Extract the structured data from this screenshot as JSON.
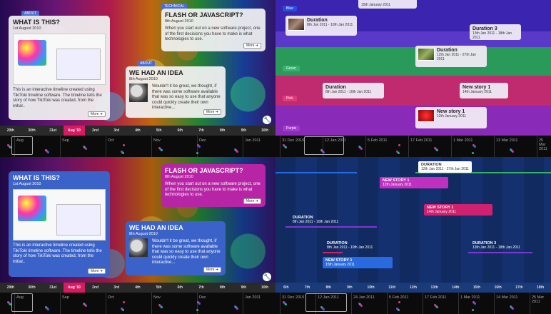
{
  "q1": {
    "about": {
      "tag": "ABOUT",
      "title": "WHAT IS THIS?",
      "date": "1st August 2010",
      "body": "This is an interactive timeline created using TikiToki timeline software. The timeline tells the story of how TikiToki was created, from the initial..",
      "more": "More"
    },
    "flash": {
      "tag": "TECHNICAL",
      "title": "FLASH OR JAVASCRIPT?",
      "date": "8th August 2010",
      "body": "When you start out on a new software project, one of the first decisions you have to make is what technologies to use.",
      "more": "More"
    },
    "idea": {
      "tag": "ABOUT",
      "title": "WE HAD AN IDEA",
      "date": "8th August 2010",
      "body": "Wouldn't it be great, we thought, if there was some software available that was so easy to use that anyone could quickly create their own interactive...",
      "more": "More"
    },
    "dates": [
      "29th",
      "30th",
      "31st",
      "Aug '10",
      "2nd",
      "3rd",
      "4th",
      "5th",
      "6th",
      "7th",
      "8th",
      "9th",
      "10th"
    ],
    "months": [
      "Aug",
      "Sep",
      "Oct",
      "Nov",
      "Dec",
      "Jan 2011"
    ]
  },
  "q2": {
    "bands": {
      "blue": "Blue",
      "green": "Green",
      "pink": "Pink",
      "purple": "Purple"
    },
    "top_card_date": "15th January 2011",
    "duration": {
      "title": "Duration",
      "date": "8th Jan 2011 - 10th Jan 2011"
    },
    "duration3": {
      "title": "Duration 3",
      "date": "13th Jan 2011 - 18th Jan 2011"
    },
    "duration2": {
      "title": "Duration",
      "date": "12th Jan 2011 - 27th Jan 2011"
    },
    "duration_pink": {
      "title": "Duration",
      "date": "8th Jan 2011 - 10th Jan 2011"
    },
    "newstory1": {
      "title": "New story 1",
      "date": "14th January 2011"
    },
    "newstory": {
      "title": "New story 1",
      "date": "12th January 2011"
    },
    "nav_dates": [
      "31 Dec 2010",
      "12 Jan 2011",
      "5 Feb 2011",
      "17 Feb 2011",
      "1 Mar 2011",
      "13 Mar 2011",
      "25 Mar 2011"
    ]
  },
  "q3": {
    "about": {
      "title": "WHAT IS THIS?",
      "date": "1st August 2010",
      "body": "This is an interactive timeline created using TikiToki timeline software. The timeline tells the story of how TikiToki was created, from the initial..",
      "more": "More"
    },
    "flash": {
      "title": "FLASH OR JAVASCRIPT?",
      "date": "8th August 2010",
      "body": "When you start out on a new software project, one of the first decisions you have to make is what technologies to use.",
      "more": "More"
    },
    "idea": {
      "title": "WE HAD AN IDEA",
      "date": "8th August 2010",
      "body": "Wouldn't it be great, we thought, if there was some software available that was so easy to use that anyone could quickly create their own interactive...",
      "more": "More"
    },
    "dates": [
      "29th",
      "30th",
      "31st",
      "Aug '10",
      "2nd",
      "3rd",
      "4th",
      "5th",
      "6th",
      "7th",
      "8th",
      "9th",
      "10th"
    ],
    "months": [
      "Aug",
      "Sep",
      "Oct",
      "Nov",
      "Dec",
      "Jan 2011"
    ]
  },
  "q4": {
    "duration_top": {
      "title": "DURATION",
      "date": "12th Jan 2011 - 27th Jan 2011"
    },
    "newstory_a": {
      "title": "NEW STORY 1",
      "date": "12th January 2011"
    },
    "newstory_b": {
      "title": "NEW STORY 1",
      "date": "14th January 2011"
    },
    "duration_mid": {
      "title": "DURATION",
      "date": "8th Jan 2011 - 10th Jan 2011"
    },
    "duration_low": {
      "title": "DURATION",
      "date": "8th Jan 2011 - 10th Jan 2011"
    },
    "duration3": {
      "title": "DURATION 3",
      "date": "13th Jan 2011 - 18th Jan 2011"
    },
    "newstory_c": {
      "title": "NEW STORY 1",
      "date": "15th January 2011"
    },
    "dates": [
      "6th",
      "7th",
      "8th",
      "9th",
      "10th",
      "11th",
      "12th",
      "13th",
      "14th",
      "15th",
      "16th",
      "17th",
      "18th"
    ],
    "nav_dates": [
      "31 Dec 2010",
      "12 Jan 2011",
      "24 Jan 2011",
      "5 Feb 2011",
      "17 Feb 2011",
      "1 Mar 2011",
      "14 Mar 2011",
      "25 Mar 2011"
    ]
  }
}
